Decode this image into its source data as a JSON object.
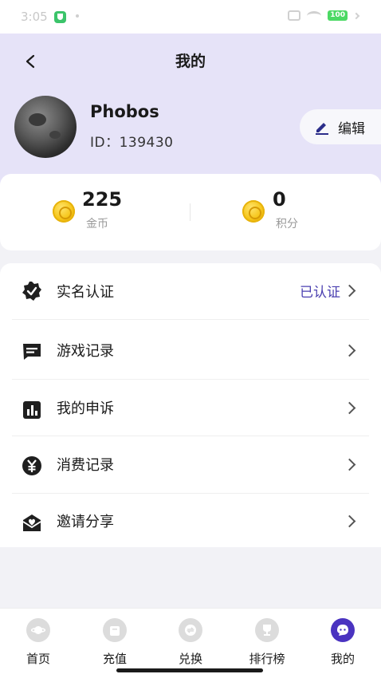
{
  "status_bar": {
    "time": "3:05",
    "battery": "100"
  },
  "header": {
    "title": "我的"
  },
  "profile": {
    "username": "Phobos",
    "user_id": "ID：139430",
    "edit_label": "编辑"
  },
  "stats": {
    "gold": {
      "value": "225",
      "label": "金币"
    },
    "points": {
      "value": "0",
      "label": "积分"
    }
  },
  "menu": {
    "items": [
      {
        "label": "实名认证",
        "status": "已认证",
        "icon": "verified-badge-icon"
      },
      {
        "label": "游戏记录",
        "icon": "message-square-icon"
      },
      {
        "label": "我的申诉",
        "icon": "bar-chart-icon"
      },
      {
        "label": "消费记录",
        "icon": "yen-circle-icon"
      },
      {
        "label": "邀请分享",
        "icon": "share-envelope-icon"
      }
    ]
  },
  "tab_bar": {
    "tabs": [
      {
        "label": "首页",
        "icon": "planet-icon"
      },
      {
        "label": "充值",
        "icon": "bag-icon"
      },
      {
        "label": "兑换",
        "icon": "exchange-icon"
      },
      {
        "label": "排行榜",
        "icon": "trophy-icon"
      },
      {
        "label": "我的",
        "icon": "chat-face-icon",
        "active": true
      }
    ]
  },
  "colors": {
    "header_bg": "#e6e3f8",
    "accent": "#4a33c0",
    "verified_text": "#4a3fb0",
    "coin": "#f5c518"
  }
}
